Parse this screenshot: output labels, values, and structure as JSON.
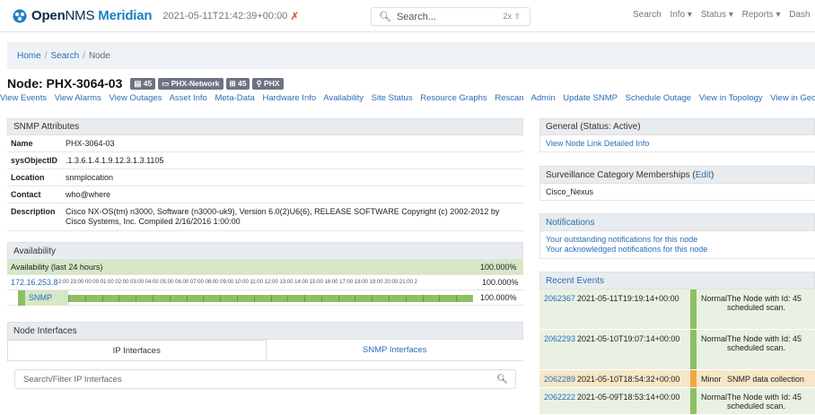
{
  "header": {
    "brand_bold": "Open",
    "brand_thin": "NMS",
    "brand_product": "Meridian",
    "datetime": "2021-05-11T21:42:39+00:00",
    "search_placeholder": "Search...",
    "search_shortcut": "2x ⇧",
    "nav": [
      "Search",
      "Info ▾",
      "Status ▾",
      "Reports ▾",
      "Dash"
    ]
  },
  "breadcrumb": {
    "home": "Home",
    "search": "Search",
    "current": "Node"
  },
  "node": {
    "title": "Node: PHX-3064-03",
    "badges": [
      "▤ 45",
      "▭ PHX-Network",
      "⊞ 45",
      "⚲ PHX"
    ]
  },
  "actions": [
    "View Events",
    "View Alarms",
    "View Outages",
    "Asset Info",
    "Meta-Data",
    "Hardware Info",
    "Availability",
    "Site Status",
    "Resource Graphs",
    "Rescan",
    "Admin",
    "Update SNMP",
    "Schedule Outage",
    "View in Topology",
    "View in Geograph"
  ],
  "snmp": {
    "heading": "SNMP Attributes",
    "rows": [
      {
        "k": "Name",
        "v": "PHX-3064-03"
      },
      {
        "k": "sysObjectID",
        "v": ".1.3.6.1.4.1.9.12.3.1.3.1105"
      },
      {
        "k": "Location",
        "v": "snmplocation"
      },
      {
        "k": "Contact",
        "v": "who@where"
      },
      {
        "k": "Description",
        "v": "Cisco NX-OS(tm) n3000, Software (n3000-uk9), Version 6.0(2)U6(6), RELEASE SOFTWARE Copyright (c) 2002-2012 by Cisco Systems, Inc. Compiled 2/16/2016 1:00:00"
      }
    ]
  },
  "availability": {
    "heading": "Availability",
    "summary_label": "Availability (last 24 hours)",
    "summary_value": "100.000%",
    "ip": "172.16.253.8",
    "ip_value": "100.000%",
    "hours": "2:00 23:00 00:00 01:00 02:00 03:00 04:00 05:00 06:00 07:00 08:00 09:00 10:00 11:00 12:00 13:00 14:00 15:00 16:00 17:00 18:00 19:00 20:00 21:00 2",
    "service": "SNMP",
    "service_value": "100.000%"
  },
  "interfaces": {
    "heading": "Node Interfaces",
    "tab_ip": "IP Interfaces",
    "tab_snmp": "SNMP Interfaces",
    "filter_placeholder": "Search/Filter IP Interfaces"
  },
  "general": {
    "heading": "General (Status: Active)",
    "link": "View Node Link Detailed Info"
  },
  "surveillance": {
    "heading_pre": "Surveillance Category Memberships (",
    "edit": "Edit",
    "heading_post": ")",
    "value": "Cisco_Nexus"
  },
  "notifications": {
    "heading": "Notifications",
    "outstanding": "Your outstanding notifications for this node",
    "acknowledged": "Your acknowledged notifications for this node"
  },
  "events": {
    "heading": "Recent Events",
    "rows": [
      {
        "id": "2062367",
        "time": "2021-05-11T19:19:14+00:00",
        "sev": "Normal",
        "msg": "The Node with Id: 45",
        "msg2": "scheduled scan."
      },
      {
        "id": "2062293",
        "time": "2021-05-10T19:07:14+00:00",
        "sev": "Normal",
        "msg": "The Node with Id: 45",
        "msg2": "scheduled scan."
      },
      {
        "id": "2062289",
        "time": "2021-05-10T18:54:32+00:00",
        "sev": "Minor",
        "msg": "SNMP data collection",
        "msg2": ""
      },
      {
        "id": "2062222",
        "time": "2021-05-09T18:53:14+00:00",
        "sev": "Normal",
        "msg": "The Node with Id: 45",
        "msg2": "scheduled scan."
      }
    ]
  }
}
